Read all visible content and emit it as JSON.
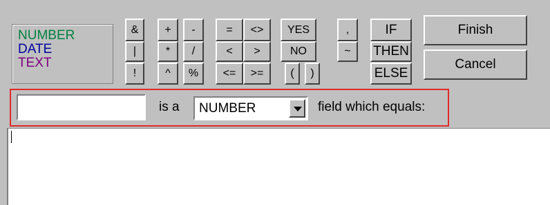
{
  "legend": {
    "number": "NUMBER",
    "date": "DATE",
    "text": "TEXT"
  },
  "colors": {
    "number": "#008040",
    "date": "#0000a0",
    "text": "#800080",
    "highlight_border": "#e02828"
  },
  "operators": {
    "ampersand": "&",
    "pipe": "|",
    "bang": "!",
    "plus": "+",
    "minus": "-",
    "times": "*",
    "divide": "/",
    "caret": "^",
    "percent": "%",
    "equals": "=",
    "not_equal": "<>",
    "less": "<",
    "greater": ">",
    "less_equal": "<=",
    "greater_equal": ">=",
    "yes": "YES",
    "no": "NO",
    "open_paren": "(",
    "close_paren": ")",
    "comma": ",",
    "tilde": "~",
    "if": "IF",
    "then": "THEN",
    "else": "ELSE"
  },
  "actions": {
    "finish": "Finish",
    "cancel": "Cancel"
  },
  "expression": {
    "field_value": "",
    "is_a": "is a",
    "type_selected": "NUMBER",
    "suffix": "field which equals:"
  },
  "formula": {
    "text": ""
  }
}
